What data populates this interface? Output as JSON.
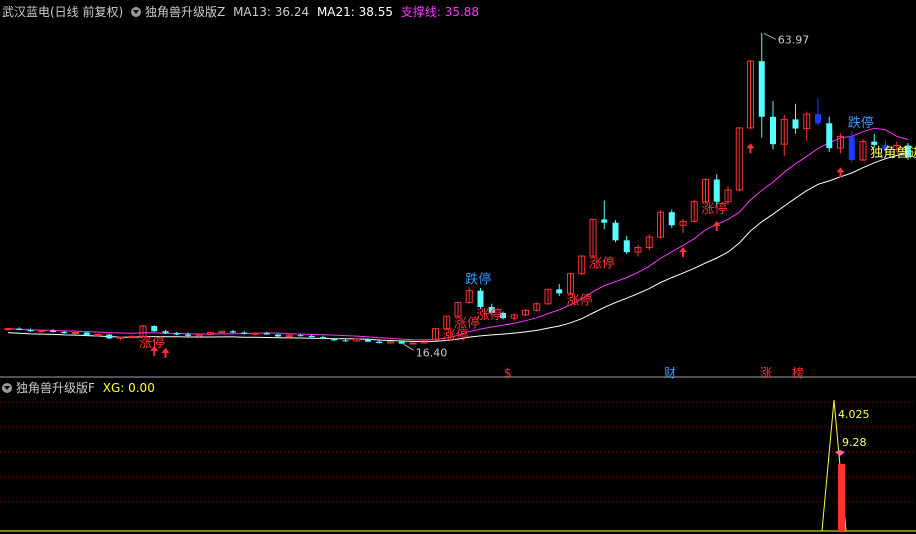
{
  "main_header": {
    "stock": "武汉蓝电(日线 前复权)",
    "indicator": "独角兽升级版Z",
    "ma13": "MA13: 36.24",
    "ma21": "MA21: 38.55",
    "support": "支撑线: 35.88"
  },
  "sub_header": {
    "indicator": "独角兽升级版F",
    "xg": "XG: 0.00"
  },
  "colors": {
    "up": "#ff3232",
    "down_cyan": "#54ffff",
    "down_blue": "#1a3cff",
    "ma13": "#ff33ff",
    "ma21": "#ffffff",
    "support": "#ff33ff",
    "xg_line": "#ffff33",
    "label_red": "#ff3232",
    "label_blue": "#3399ff",
    "text_gray": "#cccccc"
  },
  "price_labels": {
    "high": "63.97",
    "low": "16.40"
  },
  "annotations": [
    {
      "text": "涨停",
      "color": "red"
    },
    {
      "text": "涨停",
      "color": "red"
    },
    {
      "text": "涨停",
      "color": "red"
    },
    {
      "text": "跌停",
      "color": "blue"
    },
    {
      "text": "涨停",
      "color": "red"
    },
    {
      "text": "涨停",
      "color": "red"
    },
    {
      "text": "涨停",
      "color": "red"
    },
    {
      "text": "涨停",
      "color": "red"
    },
    {
      "text": "跌停",
      "color": "blue"
    },
    {
      "text": "独角兽进化",
      "color": "yellow"
    }
  ],
  "event_markers": [
    {
      "text": "$",
      "color": "red"
    },
    {
      "text": "财",
      "color": "blue"
    },
    {
      "text": "涨",
      "color": "red"
    },
    {
      "text": "榜",
      "color": "red"
    }
  ],
  "sub_labels": {
    "peak": "4.025",
    "secondary": "9.28"
  },
  "chart_data": {
    "type": "candlestick",
    "title": "武汉蓝电(日线 前复权)",
    "price_ylim": [
      14.0,
      66.0
    ],
    "candles": [
      [
        18.7,
        18.9,
        18.5,
        18.8
      ],
      [
        18.8,
        19.0,
        18.6,
        18.6
      ],
      [
        18.6,
        18.8,
        18.3,
        18.4
      ],
      [
        18.4,
        18.6,
        18.2,
        18.5
      ],
      [
        18.5,
        18.7,
        18.2,
        18.3
      ],
      [
        18.3,
        18.5,
        18.0,
        18.1
      ],
      [
        18.1,
        18.4,
        17.9,
        18.2
      ],
      [
        18.2,
        18.3,
        17.7,
        17.8
      ],
      [
        17.8,
        18.1,
        17.6,
        17.9
      ],
      [
        17.9,
        18.0,
        17.2,
        17.3
      ],
      [
        17.3,
        17.6,
        17.0,
        17.5
      ],
      [
        17.5,
        17.8,
        17.3,
        17.6
      ],
      [
        17.6,
        19.4,
        17.5,
        19.2
      ],
      [
        19.2,
        19.3,
        18.3,
        18.4
      ],
      [
        18.4,
        18.6,
        18.0,
        18.1
      ],
      [
        18.1,
        18.3,
        17.8,
        17.9
      ],
      [
        17.9,
        18.2,
        17.6,
        17.7
      ],
      [
        17.7,
        18.0,
        17.5,
        17.9
      ],
      [
        17.9,
        18.3,
        17.8,
        18.2
      ],
      [
        18.2,
        18.5,
        18.0,
        18.4
      ],
      [
        18.4,
        18.6,
        18.1,
        18.2
      ],
      [
        18.2,
        18.4,
        17.9,
        18.0
      ],
      [
        18.0,
        18.2,
        17.8,
        18.1
      ],
      [
        18.1,
        18.3,
        17.9,
        17.9
      ],
      [
        17.9,
        18.0,
        17.5,
        17.6
      ],
      [
        17.6,
        17.9,
        17.4,
        17.8
      ],
      [
        17.8,
        18.0,
        17.6,
        17.7
      ],
      [
        17.7,
        17.9,
        17.4,
        17.5
      ],
      [
        17.5,
        17.7,
        17.2,
        17.3
      ],
      [
        17.3,
        17.4,
        16.9,
        17.0
      ],
      [
        17.0,
        17.2,
        16.8,
        16.9
      ],
      [
        16.9,
        17.3,
        16.8,
        17.2
      ],
      [
        17.2,
        17.3,
        16.8,
        16.8
      ],
      [
        16.8,
        17.0,
        16.5,
        16.6
      ],
      [
        16.6,
        16.9,
        16.5,
        16.8
      ],
      [
        16.8,
        16.9,
        16.4,
        16.5
      ],
      [
        16.5,
        16.7,
        16.4,
        16.6
      ],
      [
        16.6,
        17.2,
        16.5,
        17.1
      ],
      [
        17.1,
        18.9,
        17.0,
        18.8
      ],
      [
        18.8,
        20.7,
        18.7,
        20.7
      ],
      [
        20.7,
        22.8,
        20.5,
        22.8
      ],
      [
        22.8,
        25.1,
        22.6,
        24.6
      ],
      [
        24.6,
        25.0,
        21.8,
        22.1
      ],
      [
        22.1,
        22.6,
        20.8,
        21.2
      ],
      [
        21.2,
        21.4,
        20.2,
        20.4
      ],
      [
        20.4,
        21.1,
        20.0,
        20.9
      ],
      [
        20.9,
        21.8,
        20.7,
        21.6
      ],
      [
        21.6,
        22.8,
        21.4,
        22.6
      ],
      [
        22.6,
        24.9,
        22.4,
        24.8
      ],
      [
        24.8,
        25.6,
        23.8,
        24.2
      ],
      [
        24.2,
        27.3,
        24.0,
        27.2
      ],
      [
        27.2,
        30.0,
        27.0,
        29.9
      ],
      [
        29.9,
        35.6,
        29.7,
        35.5
      ],
      [
        35.5,
        38.4,
        34.0,
        35.0
      ],
      [
        35.0,
        35.4,
        32.0,
        32.3
      ],
      [
        32.3,
        33.0,
        30.2,
        30.5
      ],
      [
        30.5,
        31.6,
        29.8,
        31.2
      ],
      [
        31.2,
        33.2,
        30.8,
        32.8
      ],
      [
        32.8,
        36.9,
        32.6,
        36.6
      ],
      [
        36.6,
        37.0,
        34.2,
        34.6
      ],
      [
        34.6,
        35.6,
        33.4,
        35.2
      ],
      [
        35.2,
        38.5,
        35.0,
        38.2
      ],
      [
        38.2,
        41.8,
        38.0,
        41.6
      ],
      [
        41.6,
        42.4,
        37.4,
        38.2
      ],
      [
        38.2,
        40.6,
        37.8,
        40.0
      ],
      [
        40.0,
        49.6,
        39.8,
        49.5
      ],
      [
        49.5,
        59.9,
        49.3,
        59.7
      ],
      [
        59.7,
        63.97,
        48.0,
        51.2
      ],
      [
        51.2,
        53.6,
        46.2,
        47.0
      ],
      [
        47.0,
        51.5,
        45.2,
        50.8
      ],
      [
        50.8,
        53.2,
        48.6,
        49.4
      ],
      [
        49.4,
        52.0,
        47.5,
        51.6
      ],
      [
        51.6,
        54.0,
        49.8,
        50.2
      ],
      [
        50.2,
        51.2,
        45.8,
        46.4
      ],
      [
        46.4,
        48.7,
        45.6,
        48.2
      ],
      [
        48.2,
        49.0,
        44.2,
        44.6
      ],
      [
        44.6,
        47.8,
        44.4,
        47.4
      ],
      [
        47.4,
        48.6,
        46.6,
        46.9
      ],
      [
        46.9,
        47.6,
        45.6,
        46.2
      ],
      [
        46.2,
        47.4,
        45.8,
        46.8
      ],
      [
        46.8,
        47.2,
        44.6,
        45.0
      ]
    ],
    "xg": {
      "peak_value": 4.025,
      "marker_value": 9.28
    }
  }
}
